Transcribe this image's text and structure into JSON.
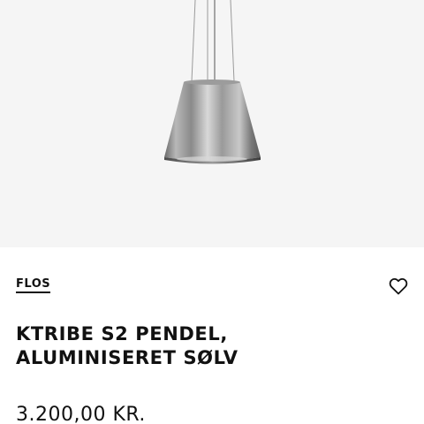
{
  "product": {
    "brand": "FLOS",
    "title_line1": "KTRIBE S2 PENDEL,",
    "title_line2": "ALUMINISERET SØLV",
    "price": "3.200,00 KR."
  },
  "icons": {
    "wishlist": "heart-outline-icon"
  },
  "colors": {
    "text": "#111111",
    "image_background": "#f5f5f5",
    "page_background": "#ffffff"
  }
}
